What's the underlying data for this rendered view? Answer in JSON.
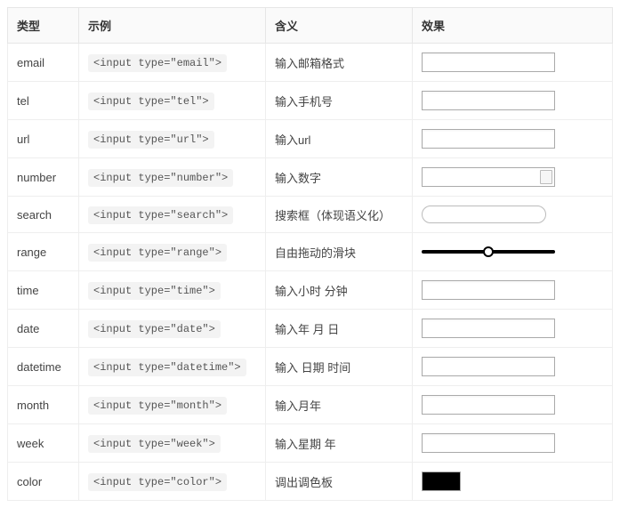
{
  "headers": {
    "type": "类型",
    "example": "示例",
    "meaning": "含义",
    "effect": "效果"
  },
  "rows": [
    {
      "type": "email",
      "code": "<input type=\"email\">",
      "meaning": "输入邮箱格式",
      "effect": "text"
    },
    {
      "type": "tel",
      "code": "<input type=\"tel\">",
      "meaning": "输入手机号",
      "effect": "text"
    },
    {
      "type": "url",
      "code": "<input type=\"url\">",
      "meaning": "输入url",
      "effect": "text"
    },
    {
      "type": "number",
      "code": "<input type=\"number\">",
      "meaning": "输入数字",
      "effect": "number"
    },
    {
      "type": "search",
      "code": "<input type=\"search\">",
      "meaning": "搜索框（体现语义化）",
      "effect": "search"
    },
    {
      "type": "range",
      "code": "<input type=\"range\">",
      "meaning": "自由拖动的滑块",
      "effect": "range"
    },
    {
      "type": "time",
      "code": "<input type=\"time\">",
      "meaning": "输入小时 分钟",
      "effect": "text"
    },
    {
      "type": "date",
      "code": "<input type=\"date\">",
      "meaning": "输入年 月 日",
      "effect": "text"
    },
    {
      "type": "datetime",
      "code": "<input type=\"datetime\">",
      "meaning": "输入 日期 时间",
      "effect": "text"
    },
    {
      "type": "month",
      "code": "<input type=\"month\">",
      "meaning": "输入月年",
      "effect": "text"
    },
    {
      "type": "week",
      "code": "<input type=\"week\">",
      "meaning": "输入星期 年",
      "effect": "text"
    },
    {
      "type": "color",
      "code": "<input type=\"color\">",
      "meaning": "调出调色板",
      "effect": "color"
    }
  ]
}
